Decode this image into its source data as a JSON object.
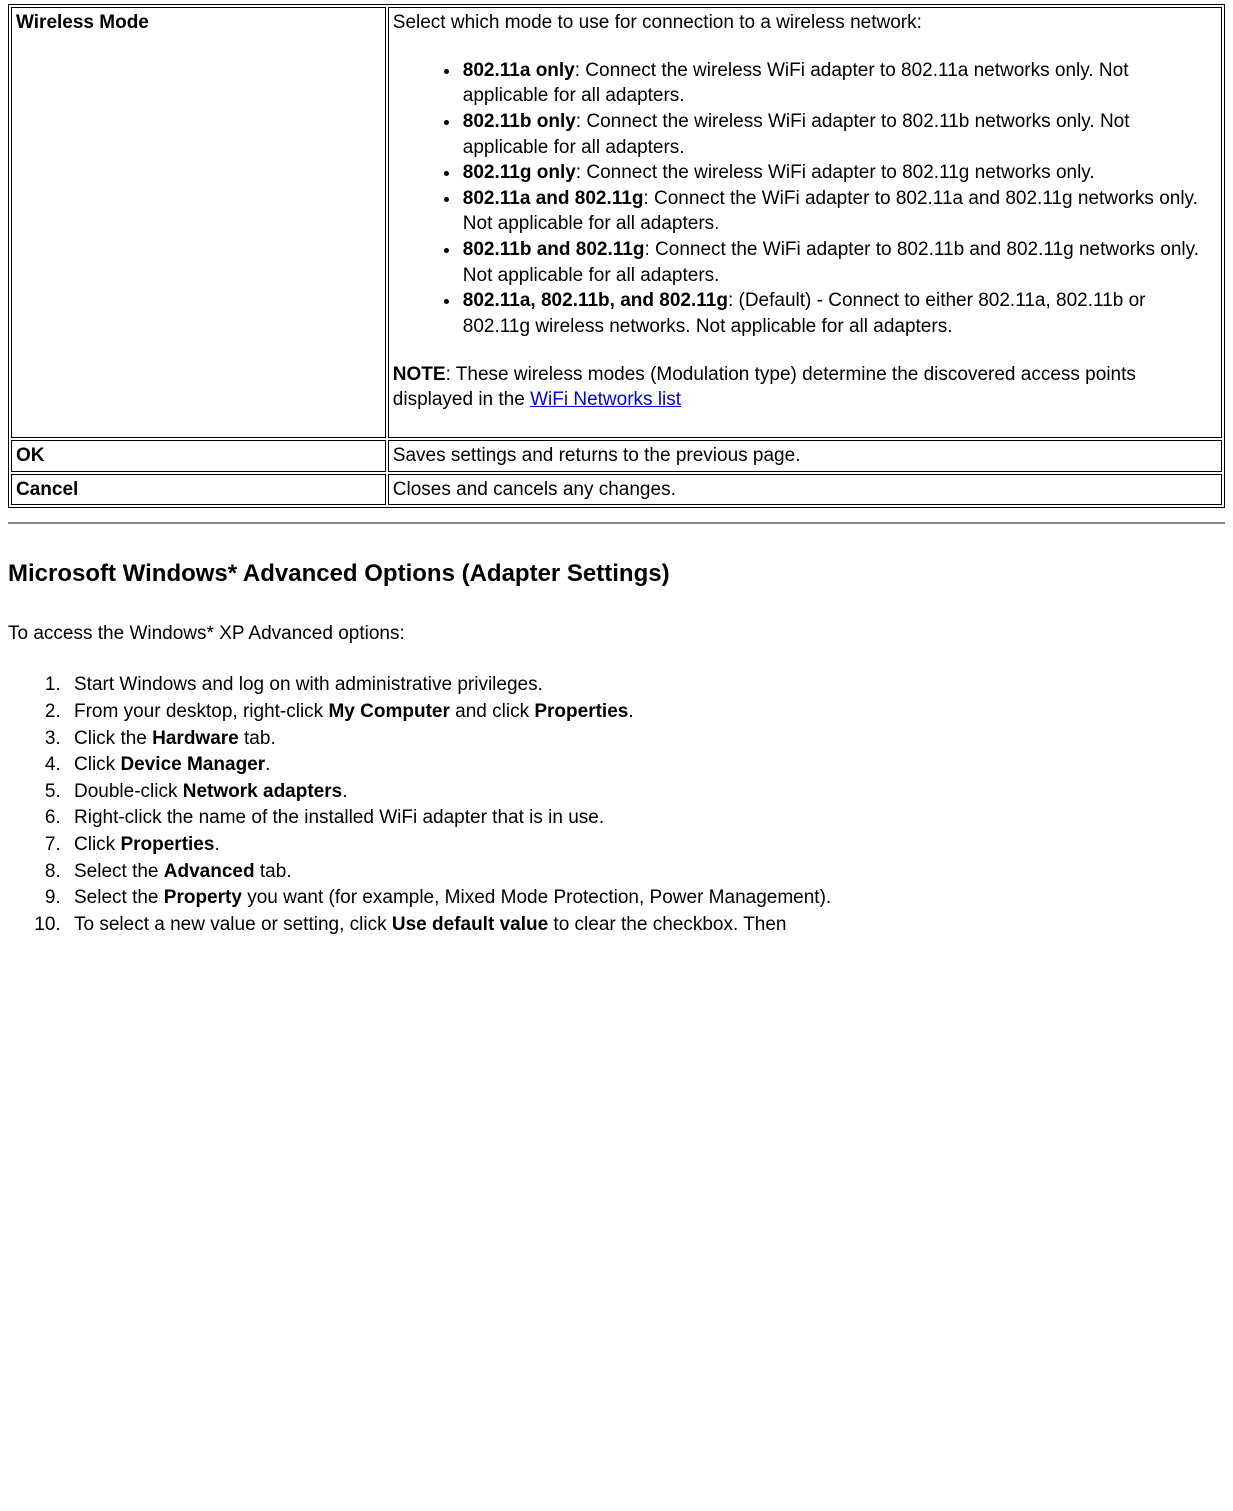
{
  "table": {
    "row1": {
      "name": "Wireless Mode",
      "intro": "Select which mode to use for connection to a wireless network:",
      "modes": [
        {
          "label": "802.11a only",
          "desc": ": Connect the wireless WiFi adapter to 802.11a networks only. Not applicable for all adapters."
        },
        {
          "label": "802.11b only",
          "desc": ": Connect the wireless WiFi adapter to 802.11b networks only. Not applicable for all adapters."
        },
        {
          "label": "802.11g only",
          "desc": ": Connect the wireless WiFi adapter to 802.11g networks only."
        },
        {
          "label": "802.11a and 802.11g",
          "desc": ": Connect the WiFi adapter to 802.11a and 802.11g networks only. Not applicable for all adapters."
        },
        {
          "label": "802.11b and 802.11g",
          "desc": ": Connect the WiFi adapter to 802.11b and 802.11g networks only. Not applicable for all adapters."
        },
        {
          "label": "802.11a, 802.11b, and 802.11g",
          "desc": ": (Default) - Connect to either 802.11a, 802.11b or 802.11g wireless networks. Not applicable for all adapters."
        }
      ],
      "note_label": "NOTE",
      "note_text1": ": These wireless modes (Modulation type) determine the discovered access points displayed in the ",
      "note_link": "WiFi Networks list"
    },
    "row2": {
      "name": "OK",
      "desc": "Saves settings and returns to the previous page."
    },
    "row3": {
      "name": "Cancel",
      "desc": "Closes and cancels any changes."
    }
  },
  "section_heading": "Microsoft Windows* Advanced Options (Adapter Settings)",
  "intro_text": "To access the Windows* XP Advanced options:",
  "steps": [
    {
      "pre": "Start Windows and log on with administrative privileges."
    },
    {
      "pre": "From your desktop, right-click ",
      "b1": "My Computer",
      "mid": " and click ",
      "b2": "Properties",
      "post": "."
    },
    {
      "pre": "Click the ",
      "b1": "Hardware",
      "post": " tab."
    },
    {
      "pre": "Click ",
      "b1": "Device Manager",
      "post": "."
    },
    {
      "pre": "Double-click ",
      "b1": "Network adapters",
      "post": "."
    },
    {
      "pre": "Right-click the name of the installed WiFi adapter that is in use."
    },
    {
      "pre": "Click ",
      "b1": "Properties",
      "post": "."
    },
    {
      "pre": "Select the ",
      "b1": "Advanced",
      "post": " tab."
    },
    {
      "pre": "Select the ",
      "b1": "Property",
      "post": " you want (for example, Mixed Mode Protection, Power Management)."
    },
    {
      "pre": "To select a new value or setting, click ",
      "b1": "Use default value",
      "post": " to clear the checkbox. Then"
    }
  ]
}
